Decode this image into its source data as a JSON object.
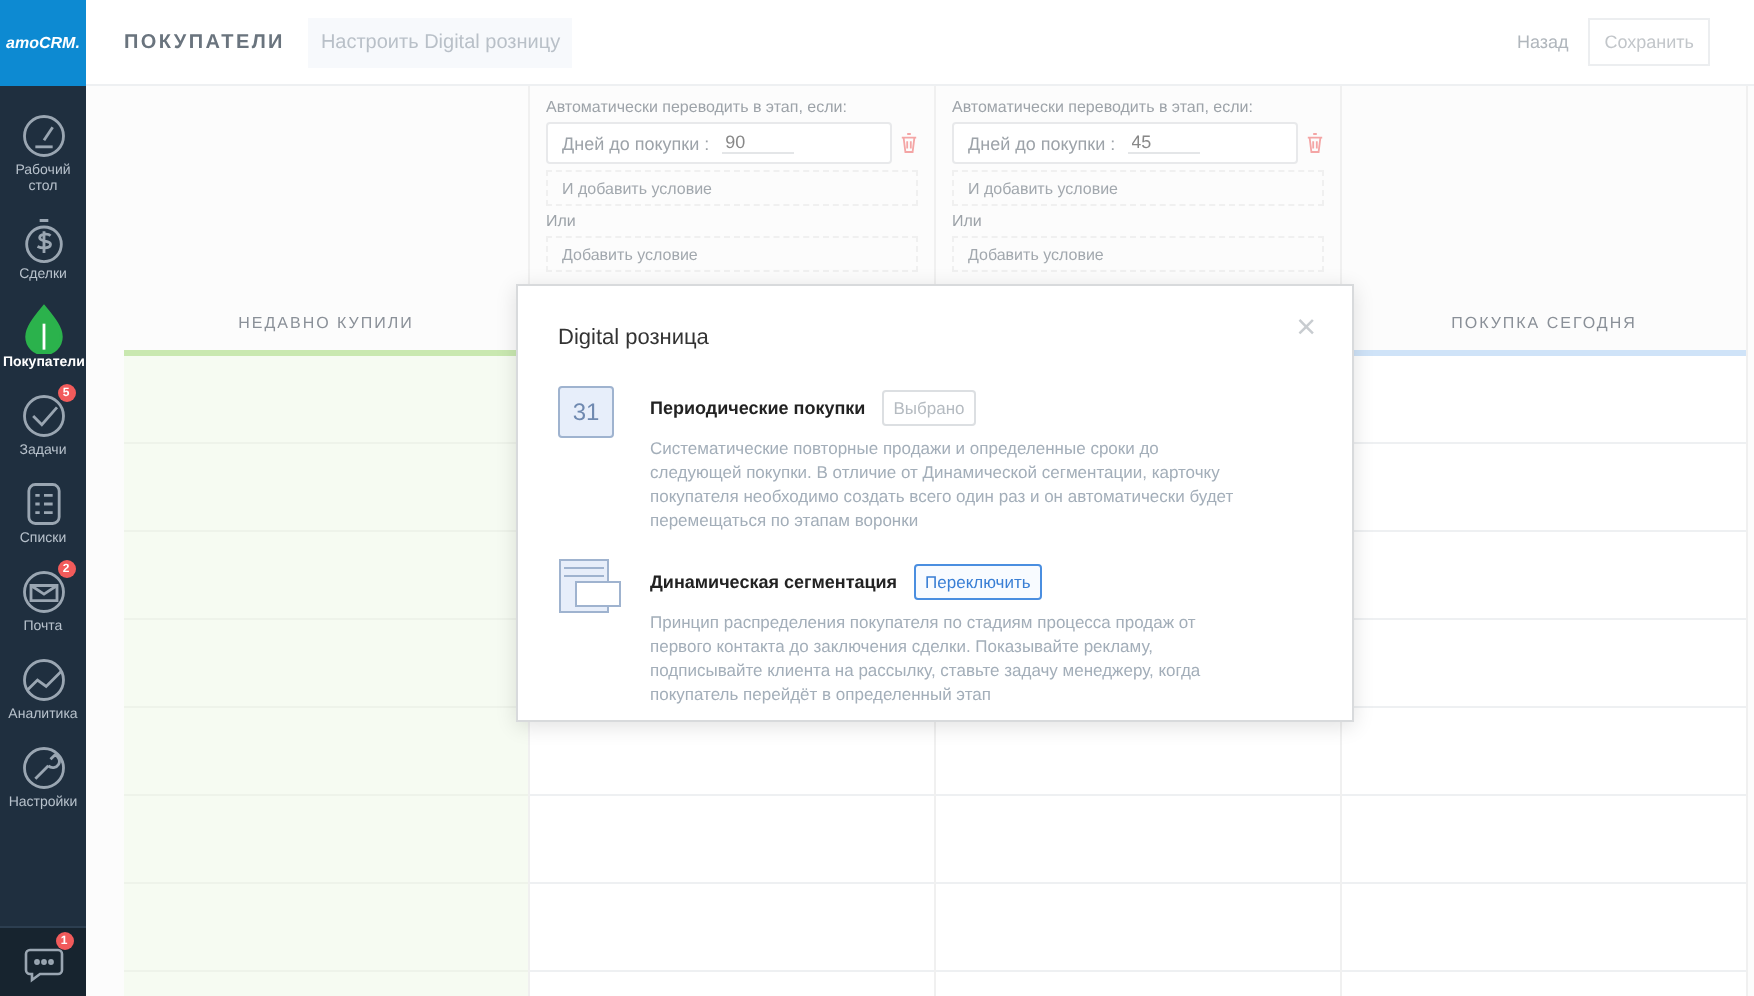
{
  "sidebar": {
    "logo": "amoCRM.",
    "items": [
      {
        "label": "Рабочий стол",
        "kind": "gauge",
        "selected": false
      },
      {
        "label": "Сделки",
        "kind": "dollar",
        "selected": false
      },
      {
        "label": "Покупатели",
        "kind": "drop",
        "selected": true
      },
      {
        "label": "Задачи",
        "kind": "check",
        "selected": false,
        "badge": "5"
      },
      {
        "label": "Списки",
        "kind": "list",
        "selected": false
      },
      {
        "label": "Почта",
        "kind": "mail",
        "selected": false,
        "badge": "2"
      },
      {
        "label": "Аналитика",
        "kind": "chart",
        "selected": false
      },
      {
        "label": "Настройки",
        "kind": "wrench",
        "selected": false
      }
    ],
    "chat": {
      "badge": "1"
    }
  },
  "header": {
    "title": "ПОКУПАТЕЛИ",
    "setup_button": "Настроить Digital розницу",
    "back_link": "Назад",
    "save_button": "Сохранить"
  },
  "columns": [
    {
      "title": "НЕДАВНО КУПИЛИ",
      "color": "#c9e8b0"
    },
    {
      "conditions": {
        "label": "Автоматически переводить в этап, если:",
        "field_label": "Дней до покупки :",
        "value": "90",
        "add_and": "И добавить условие",
        "or_label": "Или",
        "add_condition": "Добавить условие"
      }
    },
    {
      "conditions": {
        "label": "Автоматически переводить в этап, если:",
        "field_label": "Дней до покупки :",
        "value": "45",
        "add_and": "И добавить условие",
        "or_label": "Или",
        "add_condition": "Добавить условие"
      }
    },
    {
      "title": "ПОКУПКА СЕГОДНЯ",
      "color": "#cfe3f8"
    }
  ],
  "modal": {
    "title": "Digital розница",
    "close": "×",
    "options": [
      {
        "kind": "calendar",
        "calendar_day": "31",
        "title": "Периодические покупки",
        "button": "Выбрано",
        "selected": true,
        "description": "Систематические повторные продажи и определенные сроки до следующей покупки. В отличие от Динамической сегментации, карточку покупателя необходимо создать всего один раз и он автоматически будет перемещаться по этапам воронки"
      },
      {
        "kind": "layout",
        "title": "Динамическая сегментация",
        "button": "Переключить",
        "selected": false,
        "description": "Принцип распределения покупателя по стадиям процесса продаж от первого контакта до заключения сделки. Показывайте рекламу, подписывайте клиента на рассылку, ставьте задачу менеджеру, когда покупатель перейдёт в определенный этап"
      }
    ]
  }
}
